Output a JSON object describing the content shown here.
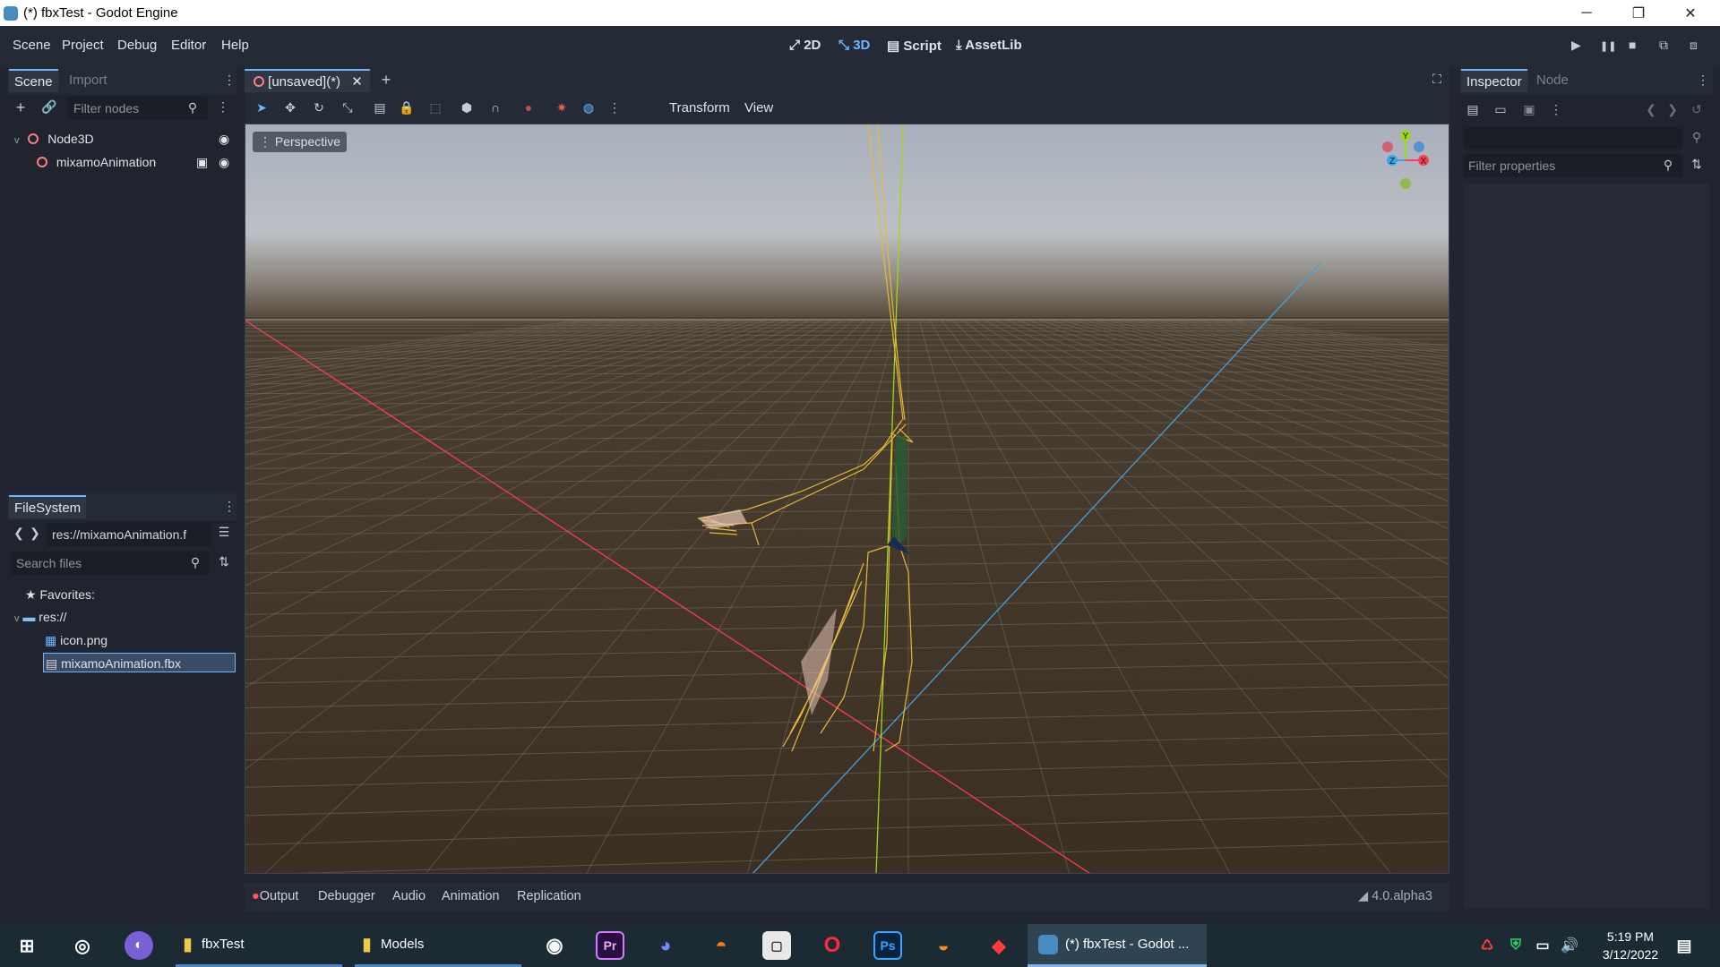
{
  "window": {
    "title": "(*) fbxTest - Godot Engine",
    "minimize": "─",
    "restore": "❐",
    "close": "✕"
  },
  "menu": {
    "items": [
      "Scene",
      "Project",
      "Debug",
      "Editor",
      "Help"
    ]
  },
  "workspaces": [
    {
      "icon": "⤢",
      "label": "2D"
    },
    {
      "icon": "⤡",
      "label": "3D"
    },
    {
      "icon": "▤",
      "label": "Script"
    },
    {
      "icon": "⤓",
      "label": "AssetLib"
    }
  ],
  "play_controls": [
    "▶",
    "❚❚",
    "■",
    "⧉",
    "⧈"
  ],
  "scene_dock": {
    "tabs": [
      "Scene",
      "Import"
    ],
    "filter_placeholder": "Filter nodes",
    "nodes": [
      {
        "label": "Node3D",
        "expanded": "v"
      },
      {
        "label": "mixamoAnimation"
      }
    ]
  },
  "filesystem_dock": {
    "tab": "FileSystem",
    "path": "res://mixamoAnimation.f",
    "search_placeholder": "Search files",
    "favorites": "Favorites:",
    "root": "res://",
    "files": [
      "icon.png",
      "mixamoAnimation.fbx"
    ]
  },
  "editor_tabs": {
    "scene_tab": "[unsaved](*)",
    "add": "+"
  },
  "viewport_toolbar": {
    "transform": "Transform",
    "view": "View"
  },
  "viewport": {
    "perspective": "Perspective",
    "gizmo_y": "Y",
    "gizmo_x": "X",
    "gizmo_z": "Z"
  },
  "bottom_panel": {
    "tabs": [
      "Output",
      "Debugger",
      "Audio",
      "Animation",
      "Replication"
    ],
    "version": "4.0.alpha3"
  },
  "inspector": {
    "tabs": [
      "Inspector",
      "Node"
    ],
    "filter_placeholder": "Filter properties"
  },
  "taskbar": {
    "apps": [
      {
        "label": "fbxTest"
      },
      {
        "label": "Models"
      },
      {
        "label": "(*) fbxTest - Godot ..."
      }
    ],
    "pinned": [
      "Pr",
      "Ps"
    ],
    "time": "5:19 PM",
    "date": "3/12/2022"
  },
  "colors": {
    "accent": "#6fb6ff",
    "x_axis": "#ff3b55",
    "y_axis": "#9ed81a",
    "z_axis": "#3aa4e8",
    "skeleton": "#e8b83a"
  }
}
